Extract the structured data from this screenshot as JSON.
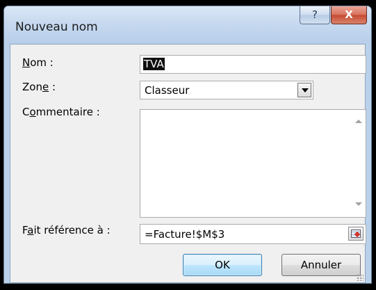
{
  "dialog": {
    "title": "Nouveau nom",
    "help_glyph": "?",
    "close_glyph": "X"
  },
  "fields": {
    "name": {
      "label_prefix": "",
      "label_underlined": "N",
      "label_rest": "om :",
      "value": "TVA"
    },
    "scope": {
      "label_prefix": "Zon",
      "label_underlined": "e",
      "label_rest": " :",
      "value": "Classeur"
    },
    "comment": {
      "label_prefix": "C",
      "label_underlined": "o",
      "label_rest": "mmentaire :",
      "value": ""
    },
    "refers_to": {
      "label_prefix": "F",
      "label_underlined": "a",
      "label_rest": "it référence à :",
      "value": "=Facture!$M$3"
    }
  },
  "buttons": {
    "ok": "OK",
    "cancel": "Annuler"
  }
}
